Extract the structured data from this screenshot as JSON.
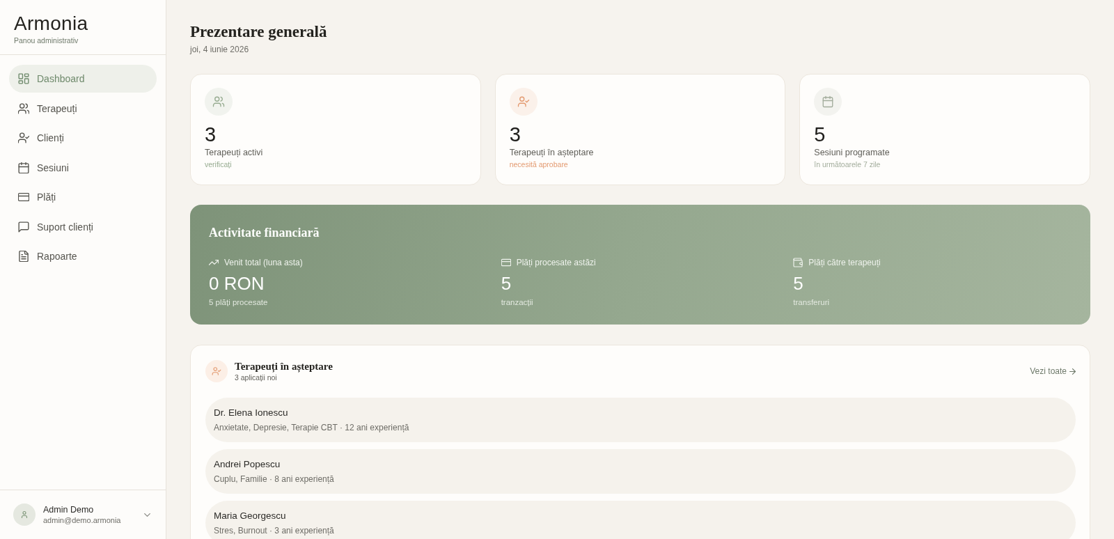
{
  "sidebar": {
    "brand": "Armonia",
    "subtitle": "Panou administrativ",
    "nav": [
      {
        "label": "Dashboard",
        "selected": true
      },
      {
        "label": "Terapeuți",
        "selected": false
      },
      {
        "label": "Clienți",
        "selected": false
      },
      {
        "label": "Sesiuni",
        "selected": false
      },
      {
        "label": "Plăți",
        "selected": false
      },
      {
        "label": "Suport clienți",
        "selected": false
      },
      {
        "label": "Rapoarte",
        "selected": false
      }
    ],
    "user": {
      "name": "Admin Demo",
      "email": "admin@demo.armonia"
    }
  },
  "header": {
    "title": "Prezentare generală",
    "date": "joi, 4 iunie 2026"
  },
  "stats": [
    {
      "value": "3",
      "label": "Terapeuți activi",
      "note": "verificați",
      "color": "#96ab90"
    },
    {
      "value": "3",
      "label": "Terapeuți în așteptare",
      "note": "necesită aprobare",
      "color": "#e39a70"
    },
    {
      "value": "5",
      "label": "Sesiuni programate",
      "note": "în următoarele 7 zile",
      "color": "#a3ad9c"
    }
  ],
  "finance": {
    "title": "Activitate financiară",
    "metrics": [
      {
        "label": "Venit total (luna asta)",
        "value": "0 RON",
        "note": "5 plăți procesate"
      },
      {
        "label": "Plăți procesate astăzi",
        "value": "5",
        "note": "tranzacții"
      },
      {
        "label": "Plăți către terapeuți",
        "value": "5",
        "note": "transferuri"
      }
    ]
  },
  "pending": {
    "title": "Terapeuți în așteptare",
    "subtitle": "3 aplicații noi",
    "link": "Vezi toate",
    "rows": [
      {
        "name": "Dr. Elena Ionescu",
        "details": "Anxietate, Depresie, Terapie CBT · 12 ani experiență"
      },
      {
        "name": "Andrei Popescu",
        "details": "Cuplu, Familie · 8 ani experiență"
      },
      {
        "name": "Maria Georgescu",
        "details": "Stres, Burnout · 3 ani experiență"
      }
    ]
  }
}
